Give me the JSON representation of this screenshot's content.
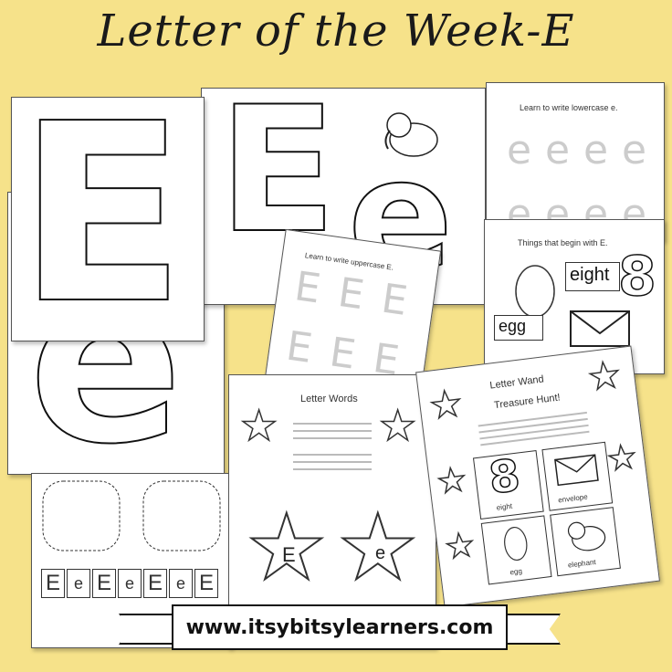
{
  "title": "Letter of the Week-E",
  "banner": "www.itsybitsylearners.com",
  "sheets": {
    "big_e": {
      "letter": "E"
    },
    "big_lower": {
      "letter": "e"
    },
    "e_card": {
      "upper": "E",
      "lower": "e"
    },
    "lowercase": {
      "heading": "Learn to write lowercase e.",
      "trace": "e"
    },
    "uppercase": {
      "heading": "Learn to write uppercase E.",
      "trace": "E"
    },
    "things": {
      "heading": "Things that begin with E.",
      "word1": "eight",
      "digit": "8",
      "word2": "egg"
    },
    "letter_words": {
      "heading": "Letter Words",
      "upper": "E",
      "lower": "e"
    },
    "treasure": {
      "heading1": "Letter Wand",
      "heading2": "Treasure Hunt!",
      "digit": "8",
      "w1": "eight",
      "w2": "envelope",
      "w3": "egg",
      "w4": "elephant"
    },
    "strip": {
      "letters": [
        "E",
        "e",
        "E",
        "e",
        "E",
        "e",
        "E"
      ]
    }
  },
  "colors": {
    "background": "#f6e28a",
    "ink": "#111111"
  }
}
